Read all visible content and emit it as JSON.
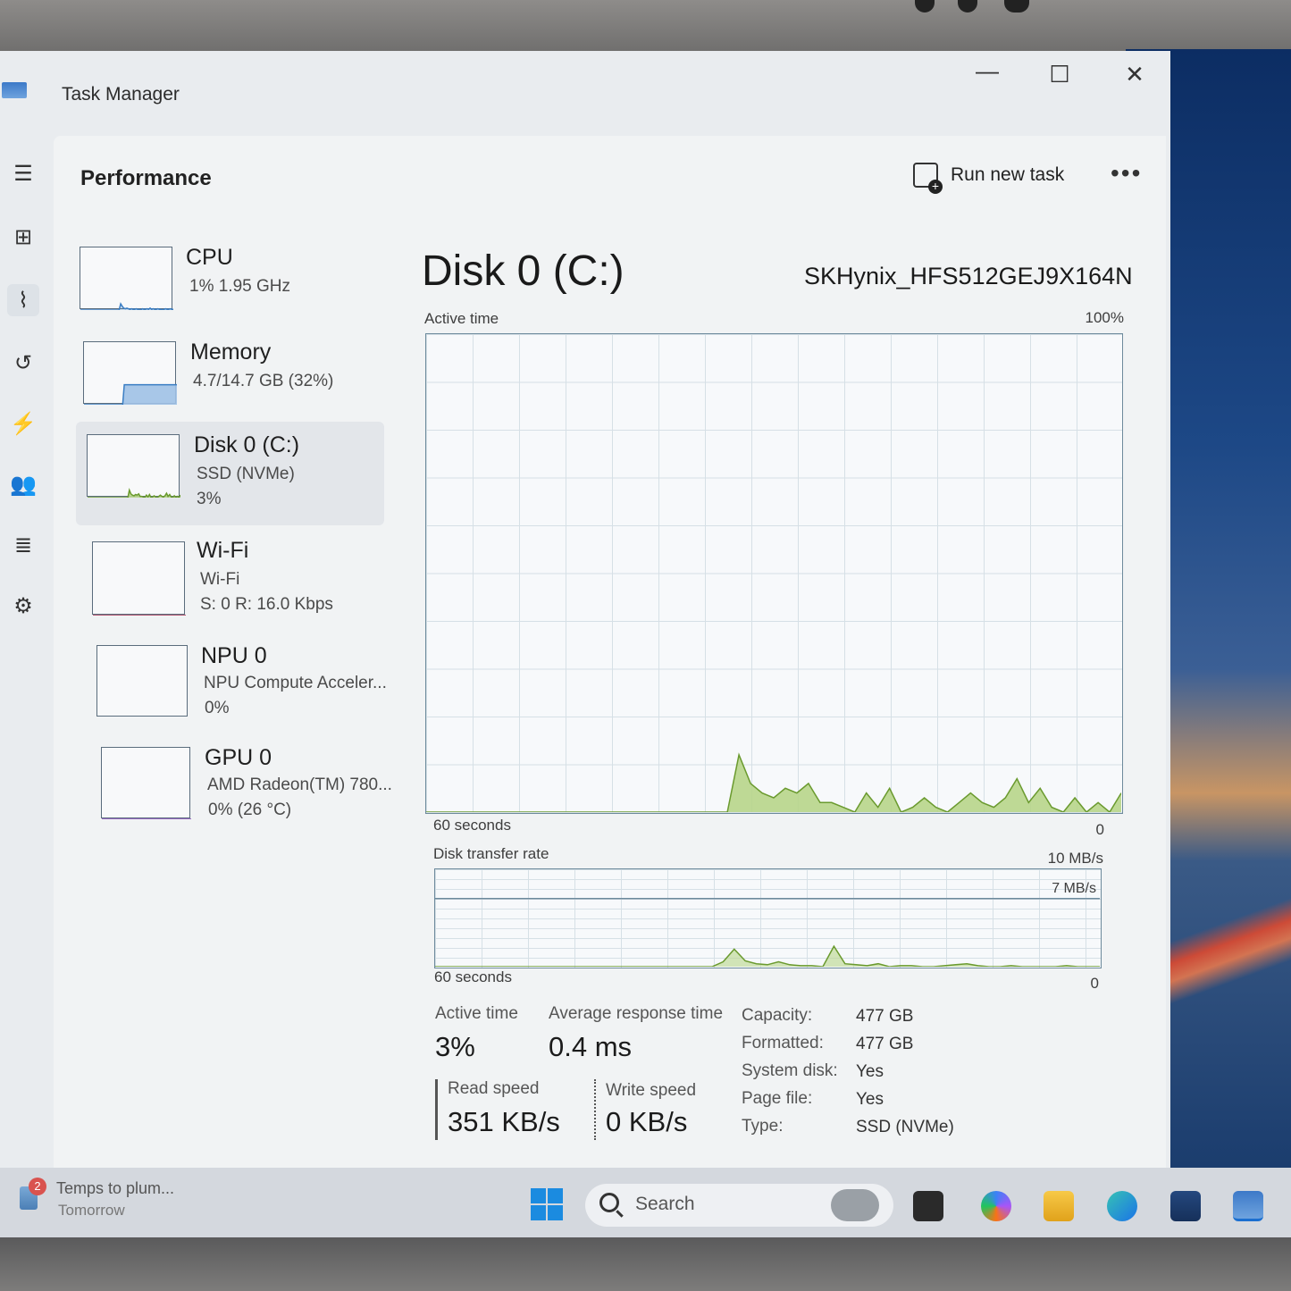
{
  "window": {
    "title": "Task Manager",
    "controls": {
      "minimize": "—",
      "maximize": "☐",
      "close": "✕"
    }
  },
  "header": {
    "title": "Performance",
    "run_new_task": "Run new task",
    "more": "•••"
  },
  "devices": [
    {
      "name": "CPU",
      "line1": "1%  1.95 GHz",
      "line2": ""
    },
    {
      "name": "Memory",
      "line1": "4.7/14.7 GB (32%)",
      "line2": ""
    },
    {
      "name": "Disk 0 (C:)",
      "line1": "SSD (NVMe)",
      "line2": "3%"
    },
    {
      "name": "Wi-Fi",
      "line1": "Wi-Fi",
      "line2": "S: 0  R: 16.0 Kbps"
    },
    {
      "name": "NPU 0",
      "line1": "NPU Compute Acceler...",
      "line2": "0%"
    },
    {
      "name": "GPU 0",
      "line1": "AMD Radeon(TM) 780...",
      "line2": "0%  (26 °C)"
    }
  ],
  "detail": {
    "title": "Disk 0 (C:)",
    "model": "SKHynix_HFS512GEJ9X164N",
    "active_graph": {
      "label": "Active time",
      "max_label": "100%",
      "x_left": "60 seconds",
      "x_right": "0",
      "max_value": 100,
      "values": [
        0,
        0,
        0,
        0,
        0,
        0,
        0,
        0,
        0,
        0,
        0,
        0,
        0,
        0,
        0,
        0,
        0,
        0,
        0,
        0,
        0,
        0,
        0,
        0,
        0,
        0,
        0,
        12,
        6,
        4,
        3,
        5,
        4,
        6,
        2,
        2,
        1,
        0,
        4,
        1,
        5,
        0,
        1,
        3,
        1,
        0,
        2,
        4,
        2,
        1,
        3,
        7,
        2,
        5,
        1,
        0,
        3,
        0,
        2,
        0,
        4
      ]
    },
    "transfer_graph": {
      "label": "Disk transfer rate",
      "max_label": "10 MB/s",
      "line_label": "7 MB/s",
      "line_value": 7,
      "x_left": "60 seconds",
      "x_right": "0",
      "max_value": 10,
      "values": [
        0,
        0,
        0,
        0,
        0,
        0,
        0,
        0,
        0,
        0,
        0,
        0,
        0,
        0,
        0,
        0,
        0,
        0,
        0,
        0,
        0,
        0,
        0,
        0,
        0,
        0,
        0.5,
        1.8,
        0.6,
        0.3,
        0.2,
        0.5,
        0.2,
        0.1,
        0.1,
        0,
        2.1,
        0.3,
        0.2,
        0.1,
        0.3,
        0,
        0.1,
        0.1,
        0,
        0,
        0.1,
        0.2,
        0.3,
        0.1,
        0,
        0,
        0.1,
        0,
        0,
        0,
        0,
        0.1,
        0,
        0,
        0
      ]
    },
    "stats": {
      "active_time_label": "Active time",
      "active_time_value": "3%",
      "avg_response_label": "Average response time",
      "avg_response_value": "0.4 ms",
      "read_label": "Read speed",
      "read_value": "351 KB/s",
      "write_label": "Write speed",
      "write_value": "0 KB/s"
    },
    "properties": [
      {
        "key": "Capacity:",
        "value": "477 GB"
      },
      {
        "key": "Formatted:",
        "value": "477 GB"
      },
      {
        "key": "System disk:",
        "value": "Yes"
      },
      {
        "key": "Page file:",
        "value": "Yes"
      },
      {
        "key": "Type:",
        "value": "SSD (NVMe)"
      }
    ]
  },
  "thumb_series": {
    "cpu": [
      0,
      0,
      0,
      0,
      0,
      0,
      0,
      0,
      0,
      0,
      0,
      0,
      0,
      0,
      0,
      0,
      0,
      0,
      0,
      0,
      0,
      0,
      0,
      0,
      0,
      0,
      10,
      6,
      3,
      2,
      3,
      2,
      1,
      2,
      1,
      1,
      2,
      1,
      1,
      0,
      2,
      1,
      1,
      2,
      1,
      3,
      1,
      2,
      1,
      1,
      2,
      1,
      1,
      0,
      1,
      2,
      1,
      1,
      2,
      1,
      1
    ],
    "memory": [
      0,
      0,
      0,
      0,
      0,
      0,
      0,
      0,
      0,
      0,
      0,
      0,
      0,
      0,
      0,
      0,
      0,
      0,
      0,
      0,
      0,
      0,
      0,
      0,
      0,
      0,
      32,
      32,
      32,
      32,
      32,
      32,
      32,
      32,
      32,
      32,
      32,
      32,
      32,
      32,
      32,
      32,
      32,
      32,
      32,
      32,
      32,
      32,
      32,
      32,
      32,
      32,
      32,
      32,
      32,
      32,
      32,
      32,
      32,
      32,
      32
    ],
    "disk": [
      0,
      0,
      0,
      0,
      0,
      0,
      0,
      0,
      0,
      0,
      0,
      0,
      0,
      0,
      0,
      0,
      0,
      0,
      0,
      0,
      0,
      0,
      0,
      0,
      0,
      0,
      0,
      12,
      6,
      4,
      3,
      5,
      4,
      6,
      2,
      2,
      1,
      0,
      4,
      1,
      5,
      0,
      1,
      3,
      1,
      0,
      2,
      4,
      2,
      1,
      3,
      7,
      2,
      5,
      1,
      0,
      3,
      0,
      2,
      0,
      4
    ],
    "wifi": [
      0,
      0,
      0,
      0,
      0,
      0,
      0,
      0,
      0,
      0,
      0,
      0,
      0,
      0,
      0,
      0,
      0,
      0,
      0,
      0,
      0,
      0,
      0,
      0,
      0,
      0,
      0,
      0,
      0,
      0,
      0,
      0,
      0,
      0,
      0,
      0,
      0,
      0,
      0,
      0,
      0,
      0,
      0,
      0,
      0,
      0,
      0,
      0,
      0,
      0,
      0,
      0,
      0,
      0,
      0,
      0,
      0,
      0,
      0,
      0,
      0
    ],
    "wifi_peaks": [
      0,
      0,
      0,
      0,
      0,
      0,
      0,
      0,
      0,
      0,
      0,
      0,
      0,
      0,
      0,
      0,
      0,
      0,
      0,
      0,
      0,
      0,
      0,
      0,
      0,
      0,
      0,
      0,
      0,
      0,
      0,
      0,
      0,
      0,
      0,
      0,
      0,
      0,
      0,
      0,
      0,
      0,
      0,
      0,
      0,
      0,
      0,
      0,
      0,
      0,
      0,
      0,
      0,
      0,
      0,
      0,
      0,
      0,
      0,
      0,
      0
    ],
    "gpu": [
      0,
      0,
      0,
      0,
      0,
      0,
      0,
      0,
      0,
      0,
      0,
      0,
      0,
      0,
      0,
      0,
      0,
      0,
      0,
      0,
      0,
      0,
      0,
      0,
      0,
      0,
      0,
      0,
      0,
      0,
      0,
      0,
      0,
      0,
      0,
      0,
      0,
      0,
      0,
      0,
      0,
      0,
      0,
      0,
      0,
      0,
      0,
      0,
      0,
      0,
      0,
      0,
      0,
      0,
      0,
      0,
      0,
      0,
      0,
      0,
      0
    ]
  },
  "taskbar": {
    "weather_badge": "2",
    "weather_line1": "Temps to plum...",
    "weather_line2": "Tomorrow",
    "search_placeholder": "Search"
  },
  "colors": {
    "disk_fill": "#b7d58a",
    "disk_stroke": "#6a9a2e",
    "cpu_line": "#3a7ec4",
    "memory_fill": "#9ec1e6",
    "wifi_line": "#a3294a",
    "gpu_line": "#7a3db0"
  }
}
